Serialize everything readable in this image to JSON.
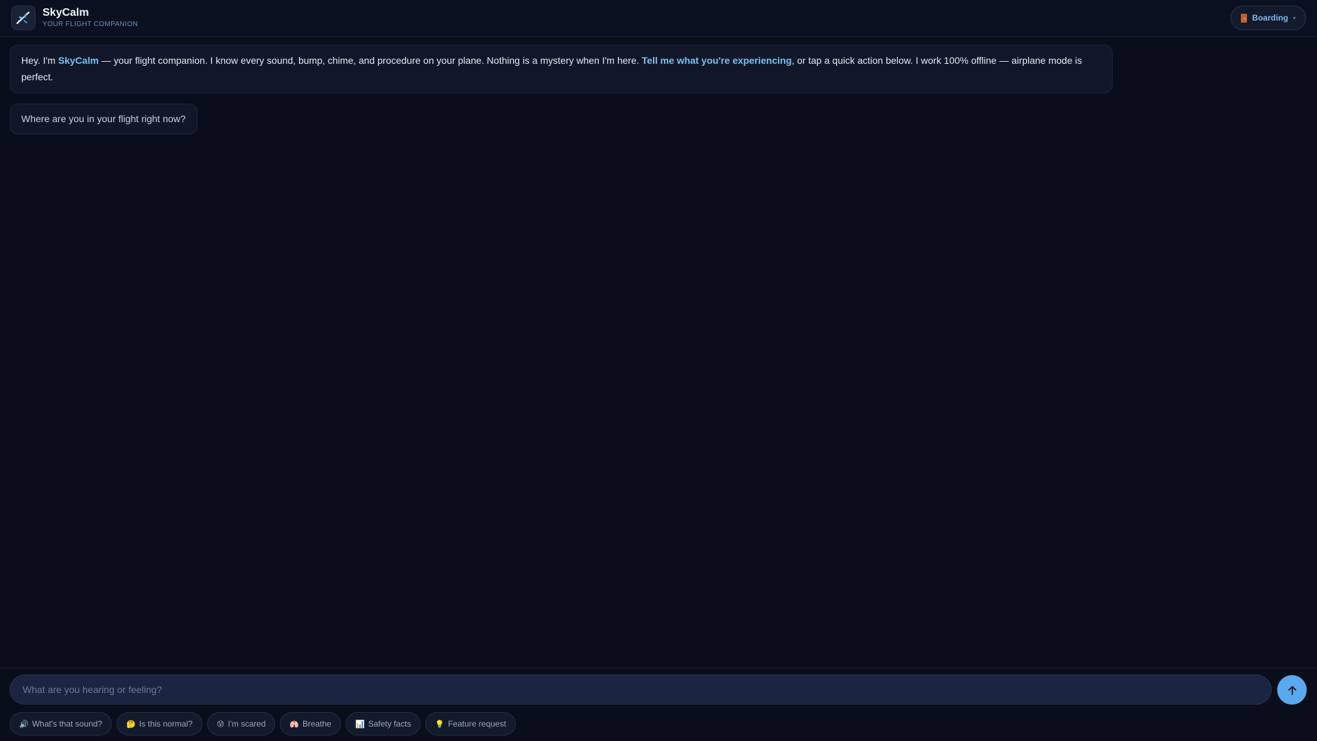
{
  "app": {
    "name": "SkyCalm",
    "tagline": "YOUR FLIGHT COMPANION"
  },
  "header": {
    "phase_icon": "door-icon",
    "phase_label": "Boarding",
    "phase_chevron": "▾"
  },
  "messages": [
    {
      "role": "assistant",
      "parts": {
        "p1": "Hey. I'm ",
        "brand": "SkyCalm",
        "p2": " — your flight companion. I know every sound, bump, chime, and procedure on your plane. Nothing is a mystery when I'm here. ",
        "link": "Tell me what you're experiencing",
        "p3": ", or tap a quick action below. I work 100% offline — airplane mode is perfect."
      }
    },
    {
      "role": "assistant",
      "text": "Where are you in your flight right now?"
    }
  ],
  "composer": {
    "placeholder": "What are you hearing or feeling?",
    "send_icon": "arrow-up-icon"
  },
  "quick_actions": [
    {
      "emoji": "🔊",
      "label": "What's that sound?"
    },
    {
      "emoji": "🤔",
      "label": "Is this normal?"
    },
    {
      "emoji": "😰",
      "label": "I'm scared"
    },
    {
      "emoji": "🫁",
      "label": "Breathe"
    },
    {
      "emoji": "📊",
      "label": "Safety facts"
    },
    {
      "emoji": "💡",
      "label": "Feature request"
    }
  ],
  "colors": {
    "background": "#0a0e1a",
    "accent": "#79c0f2",
    "send_button": "#5aa9ee",
    "bubble": "#111729"
  }
}
